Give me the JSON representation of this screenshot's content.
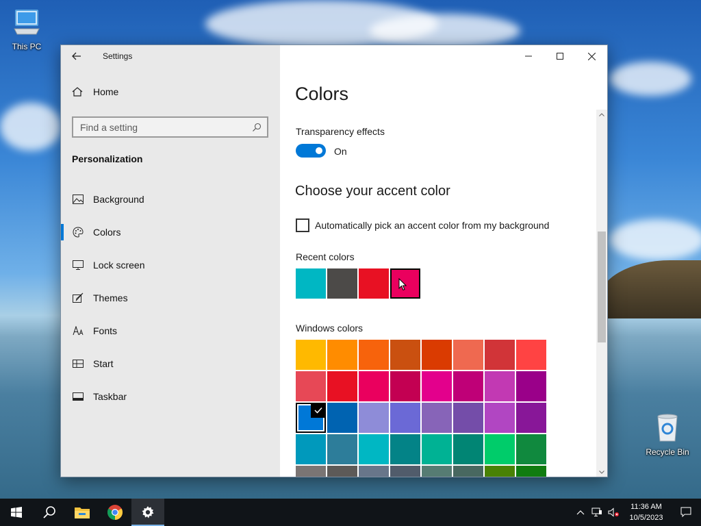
{
  "desktop": {
    "icons": [
      {
        "label": "This PC",
        "icon": "computer-icon"
      },
      {
        "label": "Recycle Bin",
        "icon": "recycle-bin-icon"
      }
    ]
  },
  "window": {
    "title": "Settings",
    "controls": {
      "minimize": "minimize-icon",
      "maximize": "maximize-icon",
      "close": "close-icon"
    }
  },
  "sidebar": {
    "home_label": "Home",
    "search_placeholder": "Find a setting",
    "section_title": "Personalization",
    "items": [
      {
        "label": "Background",
        "icon": "picture-icon"
      },
      {
        "label": "Colors",
        "icon": "palette-icon",
        "active": true
      },
      {
        "label": "Lock screen",
        "icon": "monitor-icon"
      },
      {
        "label": "Themes",
        "icon": "brush-icon"
      },
      {
        "label": "Fonts",
        "icon": "font-icon"
      },
      {
        "label": "Start",
        "icon": "start-grid-icon"
      },
      {
        "label": "Taskbar",
        "icon": "taskbar-icon"
      }
    ]
  },
  "main": {
    "title": "Colors",
    "transparency_label": "Transparency effects",
    "transparency_state": "On",
    "accent_heading": "Choose your accent color",
    "auto_pick_label": "Automatically pick an accent color from my background",
    "auto_pick_checked": false,
    "recent_label": "Recent colors",
    "recent_colors": [
      "#00b7c3",
      "#4c4a48",
      "#e81123",
      "#ea005e"
    ],
    "recent_selected_index": 3,
    "windows_label": "Windows colors",
    "windows_colors": [
      "#ffb900",
      "#ff8c00",
      "#f7630c",
      "#ca5010",
      "#da3b01",
      "#ef6950",
      "#d13438",
      "#ff4343",
      "#e74856",
      "#e81123",
      "#ea005e",
      "#c30052",
      "#e3008c",
      "#bf0077",
      "#c239b3",
      "#9a0089",
      "#0078d7",
      "#0063b1",
      "#8e8cd8",
      "#6b69d6",
      "#8764b8",
      "#744da9",
      "#b146c2",
      "#881798",
      "#0099bc",
      "#2d7d9a",
      "#00b7c3",
      "#038387",
      "#00b294",
      "#018574",
      "#00cc6a",
      "#10893e",
      "#7a7574",
      "#5d5a58",
      "#68768a",
      "#515c6b",
      "#567c73",
      "#486860",
      "#498205",
      "#107c10"
    ],
    "windows_selected_index": 16
  },
  "taskbar": {
    "apps": [
      "start-icon",
      "search-icon",
      "file-explorer-icon",
      "chrome-icon",
      "settings-icon"
    ],
    "active_app": "settings-icon",
    "time": "11:36 AM",
    "date": "10/5/2023"
  }
}
